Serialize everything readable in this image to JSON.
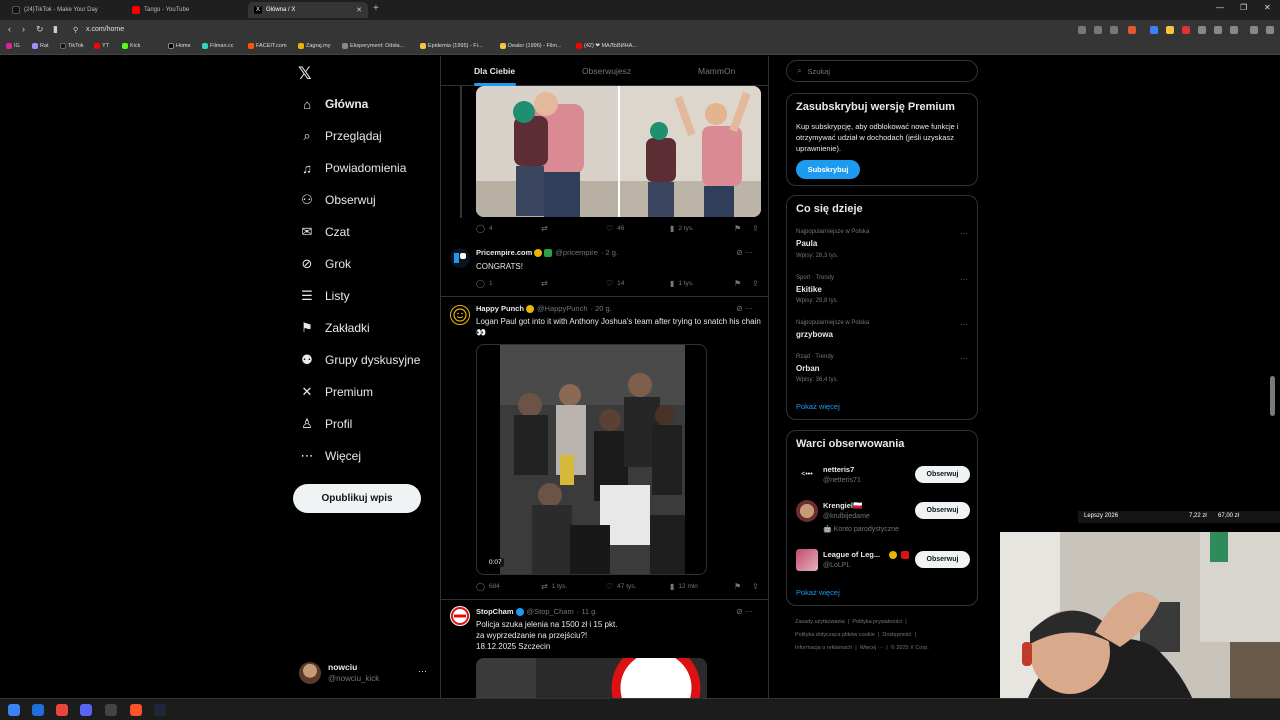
{
  "browser": {
    "tabs": [
      {
        "title": "(24)TikTok - Make Your Day",
        "active": false
      },
      {
        "title": "Tango - YouTube",
        "active": false
      },
      {
        "title": "Główna / X",
        "active": true
      }
    ],
    "url": "x.com/home",
    "bookmarks": [
      "IG",
      "Rat",
      "TikTok",
      "Kick",
      "YT",
      "Home",
      "Filman.cc",
      "FACEIT.com",
      "Zagraj.my",
      "Eksperyment: Odsła...",
      "Epidemia (1995) - Fi...",
      "Dealer (1996) - Film...",
      "(42) ❤ МАЛЬВИНА..."
    ]
  },
  "x": {
    "nav": [
      {
        "label": "Główna",
        "icon": "⌂",
        "icon_name": "home-icon"
      },
      {
        "label": "Przeglądaj",
        "icon": "⌕",
        "icon_name": "search-icon"
      },
      {
        "label": "Powiadomienia",
        "icon": "♫",
        "icon_name": "bell-icon"
      },
      {
        "label": "Obserwuj",
        "icon": "⚇",
        "icon_name": "follow-icon"
      },
      {
        "label": "Czat",
        "icon": "✉",
        "icon_name": "mail-icon"
      },
      {
        "label": "Grok",
        "icon": "⊘",
        "icon_name": "grok-icon"
      },
      {
        "label": "Listy",
        "icon": "☰",
        "icon_name": "list-icon"
      },
      {
        "label": "Zakładki",
        "icon": "⚑",
        "icon_name": "bookmark-icon"
      },
      {
        "label": "Grupy dyskusyjne",
        "icon": "⚉",
        "icon_name": "communities-icon"
      },
      {
        "label": "Premium",
        "icon": "✕",
        "icon_name": "premium-icon"
      },
      {
        "label": "Profil",
        "icon": "♙",
        "icon_name": "profile-icon"
      },
      {
        "label": "Więcej",
        "icon": "⋯",
        "icon_name": "more-icon"
      }
    ],
    "post_button": "Opublikuj wpis",
    "account": {
      "name": "nowciu",
      "handle": "@nowciu_kick"
    },
    "feed_tabs": [
      "Dla Ciebie",
      "Obserwujesz",
      "MammOn"
    ],
    "tweets": [
      {
        "stats": {
          "replies": "4",
          "reposts": "",
          "likes": "46",
          "views": "2 tys."
        }
      },
      {
        "name": "Pricempire.com",
        "handle": "@pricempire",
        "time": "· 2 g.",
        "text": "CONGRATS!",
        "stats": {
          "replies": "1",
          "reposts": "",
          "likes": "14",
          "views": "1 tys."
        }
      },
      {
        "name": "Happy Punch",
        "handle": "@HappyPunch",
        "time": "· 20 g.",
        "text": "Logan Paul got into it with Anthony Joshua's team after trying to snatch his chain 👀",
        "video_time": "0:07",
        "stats": {
          "replies": "684",
          "reposts": "1 tys.",
          "likes": "47 tys.",
          "views": "12 mln"
        }
      },
      {
        "name": "StopCham",
        "handle": "@Stop_Cham",
        "time": "· 11 g.",
        "text_lines": [
          "Policja szuka jelenia na 1500 zł i 15 pkt.",
          "za wyprzedzanie na przejściu?!",
          "18.12.2025 Szczecin"
        ]
      }
    ],
    "search_placeholder": "Szukaj",
    "premium_card": {
      "title": "Zasubskrybuj wersję Premium",
      "text": "Kup subskrypcję, aby odblokować nowe funkcje i otrzymywać udział w dochodach (jeśli uzyskasz uprawnienie).",
      "button": "Subskrybuj"
    },
    "trends_card": {
      "title": "Co się dzieje",
      "items": [
        {
          "context": "Najpopularniejsze w Polska",
          "name": "Paula",
          "count": "Wpisy: 28,3 tys."
        },
        {
          "context": "Sport · Trendy",
          "name": "Ekitike",
          "count": "Wpisy: 29,8 tys."
        },
        {
          "context": "Najpopularniejsze w Polska",
          "name": "grzybowa",
          "count": ""
        },
        {
          "context": "Rząd · Trendy",
          "name": "Orban",
          "count": "Wpisy: 36,4 tys."
        }
      ],
      "show_more": "Pokaż więcej"
    },
    "who_card": {
      "title": "Warci obserwowania",
      "items": [
        {
          "name": "netteris7",
          "handle": "@netteris71",
          "note": ""
        },
        {
          "name": "Krengiel🇵🇱",
          "handle": "@krulbijedame",
          "note": "🤖 Konto parodystyczne"
        },
        {
          "name": "League of Leg...",
          "handle": "@LoLPL",
          "note": ""
        }
      ],
      "follow_label": "Obserwuj",
      "show_more": "Pokaż więcej"
    },
    "footer": [
      "Zasady użytkowania",
      "Polityka prywatności",
      "Polityka dotycząca plików cookie",
      "Dostępność",
      "Informacja o reklamach",
      "Więcej ···",
      "© 2025 X Corp."
    ]
  },
  "ticker": {
    "label": "Lepszy 2026",
    "price": "7,22 zł",
    "total": "67,00 zł"
  },
  "colors": {
    "accent": "#1d9bf0",
    "background": "#000000",
    "border": "#2f3336",
    "muted": "#71767b"
  }
}
